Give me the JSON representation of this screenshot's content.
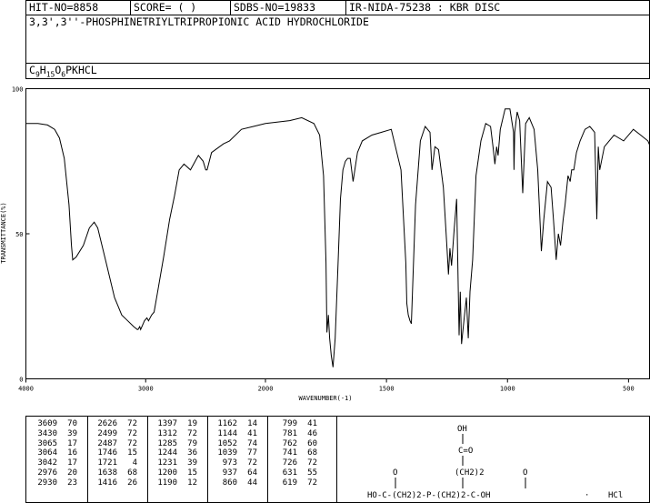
{
  "header": {
    "hit_no": "HIT-NO=8858",
    "score": "SCORE=  (   )",
    "sdbs_no": "SDBS-NO=19833",
    "ir_info": "IR-NIDA-75238 : KBR DISC",
    "compound_name": "3,3',3''-PHOSPHINETRIYLTRIPROPIONIC ACID HYDROCHLORIDE",
    "formula": "C9H15O6PKHCL"
  },
  "chart_data": {
    "type": "line",
    "xlabel": "WAVENUMBER(-1)",
    "ylabel": "TRANSMITTANCE(%)",
    "xlim": [
      4000,
      400
    ],
    "ylim": [
      0,
      100
    ],
    "x_ticks": [
      "4000",
      "3000",
      "2000",
      "1500",
      "1000",
      "500"
    ],
    "y_ticks": [
      "100",
      "50",
      "0"
    ],
    "points": [
      [
        4000,
        88
      ],
      [
        3900,
        88
      ],
      [
        3820,
        87.5
      ],
      [
        3760,
        86
      ],
      [
        3720,
        83
      ],
      [
        3680,
        76
      ],
      [
        3640,
        60
      ],
      [
        3620,
        46
      ],
      [
        3609,
        41
      ],
      [
        3580,
        42
      ],
      [
        3520,
        46
      ],
      [
        3470,
        52
      ],
      [
        3430,
        54
      ],
      [
        3400,
        52
      ],
      [
        3330,
        40
      ],
      [
        3260,
        28
      ],
      [
        3200,
        22
      ],
      [
        3150,
        20
      ],
      [
        3100,
        18
      ],
      [
        3070,
        17
      ],
      [
        3064,
        17
      ],
      [
        3050,
        18
      ],
      [
        3042,
        17
      ],
      [
        3010,
        20
      ],
      [
        2990,
        21
      ],
      [
        2976,
        20
      ],
      [
        2950,
        22
      ],
      [
        2930,
        23
      ],
      [
        2900,
        30
      ],
      [
        2850,
        42
      ],
      [
        2800,
        55
      ],
      [
        2760,
        63
      ],
      [
        2720,
        72
      ],
      [
        2680,
        74
      ],
      [
        2626,
        72
      ],
      [
        2560,
        77
      ],
      [
        2520,
        75
      ],
      [
        2499,
        72
      ],
      [
        2487,
        72
      ],
      [
        2450,
        78
      ],
      [
        2350,
        81
      ],
      [
        2300,
        82
      ],
      [
        2200,
        86
      ],
      [
        2100,
        87
      ],
      [
        2000,
        88
      ],
      [
        1900,
        89
      ],
      [
        1850,
        90
      ],
      [
        1800,
        88
      ],
      [
        1776,
        84
      ],
      [
        1760,
        70
      ],
      [
        1750,
        40
      ],
      [
        1746,
        16
      ],
      [
        1740,
        22
      ],
      [
        1735,
        14
      ],
      [
        1728,
        8
      ],
      [
        1721,
        4
      ],
      [
        1712,
        14
      ],
      [
        1700,
        40
      ],
      [
        1690,
        62
      ],
      [
        1680,
        72
      ],
      [
        1670,
        75
      ],
      [
        1660,
        76
      ],
      [
        1650,
        76
      ],
      [
        1638,
        68
      ],
      [
        1620,
        78
      ],
      [
        1600,
        82
      ],
      [
        1560,
        84
      ],
      [
        1520,
        85
      ],
      [
        1480,
        86
      ],
      [
        1440,
        72
      ],
      [
        1420,
        40
      ],
      [
        1416,
        26
      ],
      [
        1410,
        22
      ],
      [
        1403,
        20
      ],
      [
        1397,
        19
      ],
      [
        1380,
        60
      ],
      [
        1360,
        82
      ],
      [
        1340,
        87
      ],
      [
        1320,
        85
      ],
      [
        1312,
        72
      ],
      [
        1300,
        80
      ],
      [
        1285,
        79
      ],
      [
        1265,
        66
      ],
      [
        1250,
        45
      ],
      [
        1244,
        36
      ],
      [
        1238,
        45
      ],
      [
        1231,
        39
      ],
      [
        1220,
        52
      ],
      [
        1210,
        62
      ],
      [
        1200,
        15
      ],
      [
        1195,
        30
      ],
      [
        1190,
        12
      ],
      [
        1180,
        20
      ],
      [
        1170,
        28
      ],
      [
        1162,
        14
      ],
      [
        1155,
        30
      ],
      [
        1144,
        41
      ],
      [
        1130,
        70
      ],
      [
        1110,
        82
      ],
      [
        1090,
        88
      ],
      [
        1070,
        87
      ],
      [
        1060,
        80
      ],
      [
        1052,
        74
      ],
      [
        1045,
        80
      ],
      [
        1039,
        77
      ],
      [
        1030,
        86
      ],
      [
        1010,
        93
      ],
      [
        990,
        93
      ],
      [
        975,
        85
      ],
      [
        973,
        72
      ],
      [
        970,
        85
      ],
      [
        960,
        92
      ],
      [
        950,
        89
      ],
      [
        937,
        64
      ],
      [
        925,
        88
      ],
      [
        910,
        90
      ],
      [
        890,
        86
      ],
      [
        875,
        72
      ],
      [
        860,
        44
      ],
      [
        850,
        55
      ],
      [
        835,
        68
      ],
      [
        820,
        66
      ],
      [
        810,
        55
      ],
      [
        799,
        41
      ],
      [
        790,
        50
      ],
      [
        781,
        46
      ],
      [
        770,
        55
      ],
      [
        762,
        60
      ],
      [
        750,
        70
      ],
      [
        741,
        68
      ],
      [
        735,
        72
      ],
      [
        726,
        72
      ],
      [
        715,
        78
      ],
      [
        700,
        82
      ],
      [
        680,
        86
      ],
      [
        660,
        87
      ],
      [
        640,
        85
      ],
      [
        631,
        55
      ],
      [
        625,
        80
      ],
      [
        619,
        72
      ],
      [
        600,
        80
      ],
      [
        560,
        84
      ],
      [
        520,
        82
      ],
      [
        480,
        86
      ],
      [
        450,
        84
      ],
      [
        420,
        82
      ],
      [
        400,
        78
      ]
    ],
    "peak_table": [
      {
        "wn": "3609",
        "t": "70"
      },
      {
        "wn": "3430",
        "t": "39"
      },
      {
        "wn": "3065",
        "t": "17"
      },
      {
        "wn": "3064",
        "t": "16"
      },
      {
        "wn": "3042",
        "t": "17"
      },
      {
        "wn": "2976",
        "t": "20"
      },
      {
        "wn": "2930",
        "t": "23"
      },
      {
        "wn": "2626",
        "t": "72"
      },
      {
        "wn": "2499",
        "t": "72"
      },
      {
        "wn": "2487",
        "t": "72"
      },
      {
        "wn": "1746",
        "t": "15"
      },
      {
        "wn": "1721",
        "t": "4"
      },
      {
        "wn": "1638",
        "t": "68"
      },
      {
        "wn": "1416",
        "t": "26"
      },
      {
        "wn": "1397",
        "t": "19"
      },
      {
        "wn": "1312",
        "t": "72"
      },
      {
        "wn": "1285",
        "t": "79"
      },
      {
        "wn": "1244",
        "t": "36"
      },
      {
        "wn": "1231",
        "t": "39"
      },
      {
        "wn": "1200",
        "t": "15"
      },
      {
        "wn": "1190",
        "t": "12"
      },
      {
        "wn": "1162",
        "t": "14"
      },
      {
        "wn": "1144",
        "t": "41"
      },
      {
        "wn": "1052",
        "t": "74"
      },
      {
        "wn": "1039",
        "t": "77"
      },
      {
        "wn": "973",
        "t": "72"
      },
      {
        "wn": "937",
        "t": "64"
      },
      {
        "wn": "860",
        "t": "44"
      },
      {
        "wn": "799",
        "t": "41"
      },
      {
        "wn": "781",
        "t": "46"
      },
      {
        "wn": "762",
        "t": "60"
      },
      {
        "wn": "741",
        "t": "68"
      },
      {
        "wn": "726",
        "t": "72"
      },
      {
        "wn": "631",
        "t": "55"
      },
      {
        "wn": "619",
        "t": "72"
      }
    ]
  },
  "structure": {
    "oh_top": "OH",
    "c_o_top": "C=O",
    "ch2_top": "(CH2)2",
    "o_left": "O",
    "o_right": "O",
    "main_chain": "HO-C-(CH2)2-P-(CH2)2-C-OH",
    "salt": "HCl"
  }
}
